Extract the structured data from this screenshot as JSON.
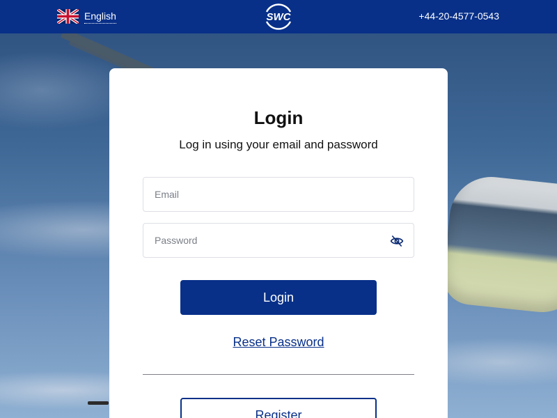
{
  "header": {
    "language_label": "English",
    "language_flag_icon": "uk-flag-icon",
    "logo_text": "SWC",
    "phone": "+44-20-4577-0543",
    "background_color": "#083089"
  },
  "login_card": {
    "title": "Login",
    "subtitle": "Log in using your email and password",
    "email_placeholder": "Email",
    "email_value": "",
    "password_placeholder": "Password",
    "password_value": "",
    "password_toggle_icon": "eye-slash-icon",
    "login_button_label": "Login",
    "reset_password_link": "Reset Password",
    "register_button_label": "Register"
  },
  "colors": {
    "primary": "#083089",
    "card_background": "#ffffff",
    "text": "#111111"
  }
}
